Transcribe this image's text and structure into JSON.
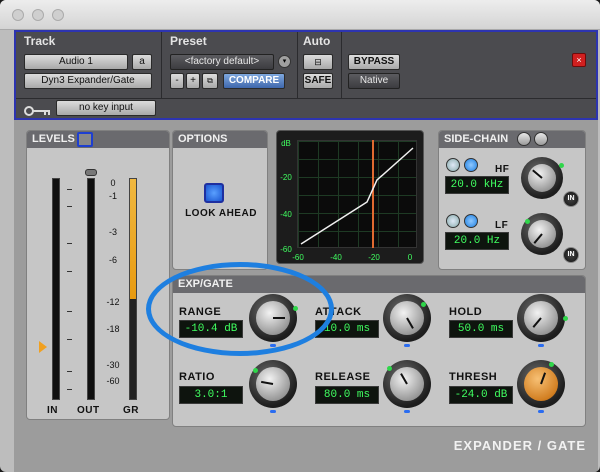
{
  "window": {
    "buttons": [
      "close",
      "minimize",
      "zoom"
    ]
  },
  "header": {
    "track": {
      "title": "Track",
      "name": "Audio 1",
      "name_suffix": "a",
      "plugin": "Dyn3 Expander/Gate"
    },
    "preset": {
      "title": "Preset",
      "value": "<factory default>",
      "minus": "-",
      "plus": "+",
      "compare": "COMPARE"
    },
    "auto": {
      "title": "Auto",
      "safe": "SAFE"
    },
    "bypass": "BYPASS",
    "mode": "Native",
    "key_input": "no key input",
    "icons": {
      "key": "key-icon",
      "close": "close-icon"
    }
  },
  "levels": {
    "title": "LEVELS",
    "ticks": [
      "0",
      "-1",
      "-3",
      "-6",
      "-12",
      "-18",
      "-30",
      "-60"
    ],
    "labels": {
      "in": "IN",
      "out": "OUT",
      "gr": "GR"
    }
  },
  "options": {
    "title": "OPTIONS",
    "look_ahead": "LOOK AHEAD"
  },
  "graph": {
    "y_ticks": [
      "dB",
      "-20",
      "-40",
      "-60"
    ],
    "x_ticks": [
      "-60",
      "-40",
      "-20",
      "0"
    ]
  },
  "sidechain": {
    "title": "SIDE-CHAIN",
    "hf_label": "HF",
    "hf_value": "20.0 kHz",
    "lf_label": "LF",
    "lf_value": "20.0 Hz",
    "in_label": "IN"
  },
  "expgate": {
    "title": "EXP/GATE",
    "range": {
      "label": "RANGE",
      "value": "-10.4 dB"
    },
    "attack": {
      "label": "ATTACK",
      "value": "10.0 ms"
    },
    "hold": {
      "label": "HOLD",
      "value": "50.0 ms"
    },
    "ratio": {
      "label": "RATIO",
      "value": "3.0:1"
    },
    "release": {
      "label": "RELEASE",
      "value": "80.0 ms"
    },
    "thresh": {
      "label": "THRESH",
      "value": "-24.0 dB"
    }
  },
  "brand": "EXPANDER / GATE",
  "colors": {
    "accent_blue": "#2d34b0",
    "display_green": "#40ff60",
    "highlight": "#1e7fe0",
    "meter_orange": "#f0a020",
    "thresh_line": "#e06a30"
  }
}
